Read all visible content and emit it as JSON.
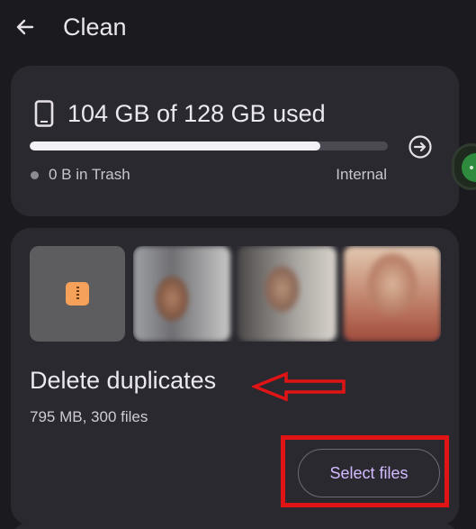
{
  "header": {
    "title": "Clean",
    "back_icon": "arrow-left-icon"
  },
  "storage": {
    "used_text": "104 GB of 128 GB used",
    "used_fraction": 0.8125,
    "trash_text": "0 B in Trash",
    "location": "Internal",
    "icon": "phone-icon",
    "action_icon": "arrow-right-circle-icon"
  },
  "duplicates": {
    "title": "Delete duplicates",
    "summary": "795 MB, 300 files",
    "button_label": "Select files",
    "thumbnails": [
      "zip-file-icon",
      "blurred-photo",
      "blurred-photo",
      "blurred-photo"
    ]
  },
  "colors": {
    "accent": "#d4bbff",
    "annotation": "#e01414",
    "background": "#1b1a1f",
    "card": "#2a2930"
  }
}
